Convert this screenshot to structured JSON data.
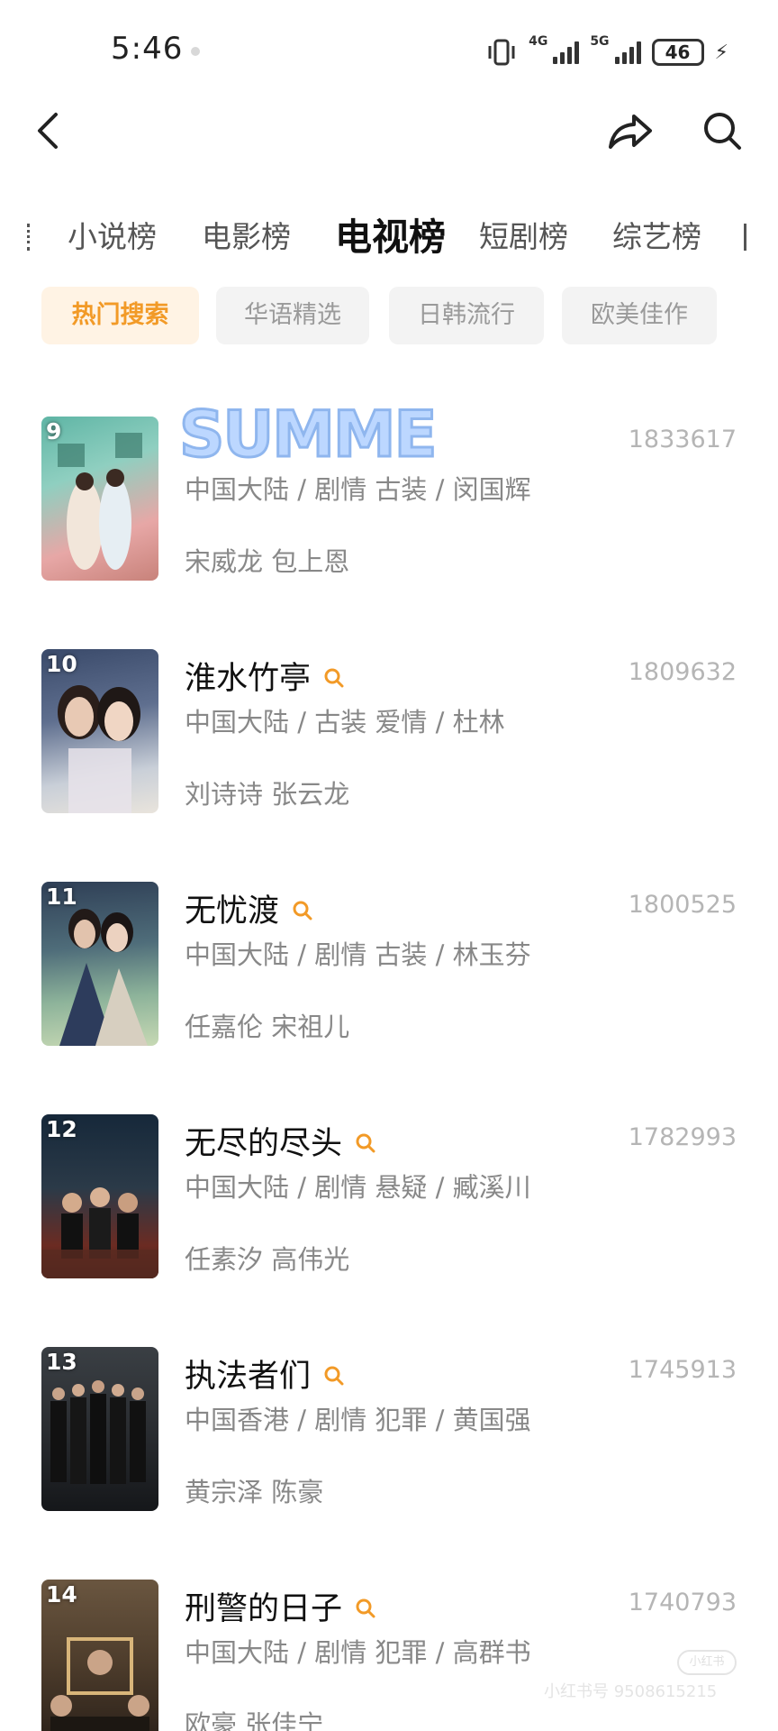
{
  "status_bar": {
    "time": "5:46",
    "net1": "4G",
    "net2": "5G",
    "battery": "46"
  },
  "header": {
    "back_icon": "back-arrow-icon",
    "share_icon": "share-icon",
    "search_icon": "search-icon"
  },
  "category_tabs": [
    {
      "label": "小说榜",
      "active": false
    },
    {
      "label": "电影榜",
      "active": false
    },
    {
      "label": "电视榜",
      "active": true
    },
    {
      "label": "短剧榜",
      "active": false
    },
    {
      "label": "综艺榜",
      "active": false
    }
  ],
  "filters": [
    {
      "label": "热门搜索",
      "active": true
    },
    {
      "label": "华语精选",
      "active": false
    },
    {
      "label": "日韩流行",
      "active": false
    },
    {
      "label": "欧美佳作",
      "active": false
    }
  ],
  "items": [
    {
      "rank": "9",
      "title": "",
      "score": "1833617",
      "meta": "中国大陆 / 剧情 古装 / 闵国辉",
      "cast": "宋威龙 包上恩"
    },
    {
      "rank": "10",
      "title": "淮水竹亭",
      "score": "1809632",
      "meta": "中国大陆 / 古装 爱情 / 杜林",
      "cast": "刘诗诗 张云龙"
    },
    {
      "rank": "11",
      "title": "无忧渡",
      "score": "1800525",
      "meta": "中国大陆 / 剧情 古装 / 林玉芬",
      "cast": "任嘉伦 宋祖儿"
    },
    {
      "rank": "12",
      "title": "无尽的尽头",
      "score": "1782993",
      "meta": "中国大陆 / 剧情 悬疑 / 臧溪川",
      "cast": "任素汐 高伟光"
    },
    {
      "rank": "13",
      "title": "执法者们",
      "score": "1745913",
      "meta": "中国香港 / 剧情 犯罪 / 黄国强",
      "cast": "黄宗泽 陈豪"
    },
    {
      "rank": "14",
      "title": "刑警的日子",
      "score": "1740793",
      "meta": "中国大陆 / 剧情 犯罪 / 高群书",
      "cast": "欧豪 张佳宁"
    }
  ],
  "overlay": {
    "summer_text": "SUMMER"
  },
  "watermark": {
    "text": "小红书号 9508615215",
    "badge": "小红书"
  },
  "colors": {
    "accent": "#f29a27",
    "accent_bg": "#fff3e4",
    "muted": "#888888"
  }
}
